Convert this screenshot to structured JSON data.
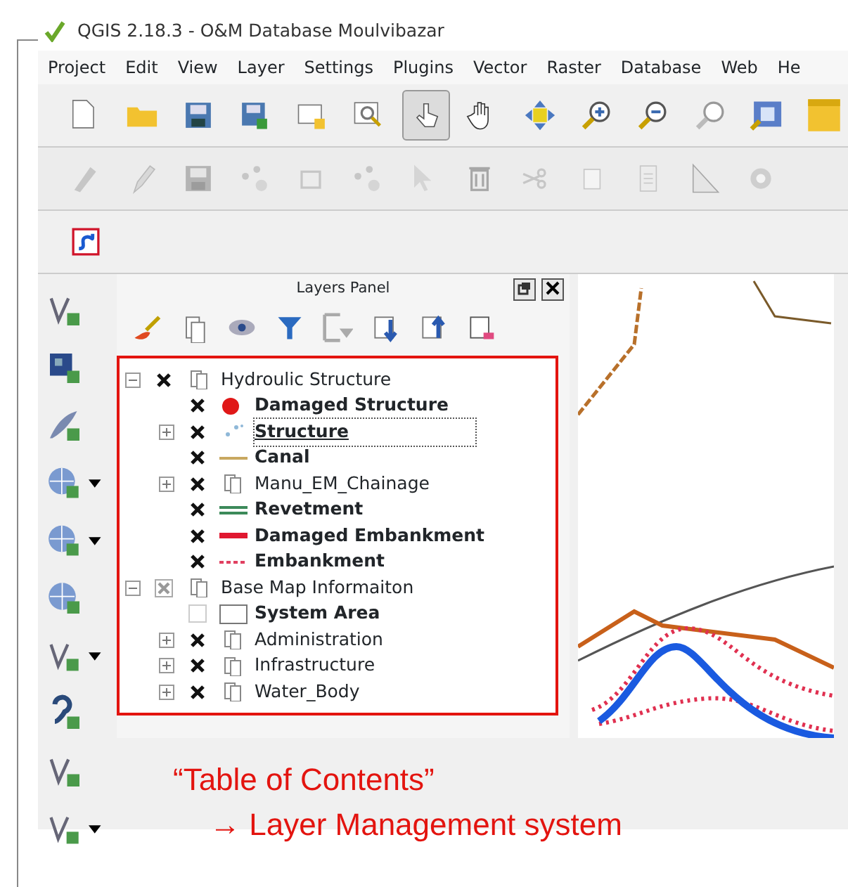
{
  "window": {
    "title": "QGIS 2.18.3 - O&M Database Moulvibazar"
  },
  "menu": [
    "Project",
    "Edit",
    "View",
    "Layer",
    "Settings",
    "Plugins",
    "Vector",
    "Raster",
    "Database",
    "Web",
    "He"
  ],
  "toolbars": [
    {
      "disabled": false,
      "buttons": [
        {
          "selected": false
        },
        {
          "selected": false
        },
        {
          "selected": false
        },
        {
          "selected": false
        },
        {
          "selected": false
        },
        {
          "selected": false
        },
        {
          "selected": true
        },
        {
          "selected": false
        },
        {
          "selected": false
        },
        {
          "selected": false
        },
        {
          "selected": false
        },
        {
          "selected": false
        },
        {
          "selected": false
        },
        {
          "selected": false
        }
      ]
    },
    {
      "disabled": true,
      "buttons": [
        {
          "selected": false
        },
        {
          "selected": false
        },
        {
          "selected": false
        },
        {
          "selected": false
        },
        {
          "selected": false
        },
        {
          "selected": false
        },
        {
          "selected": false
        },
        {
          "selected": false
        },
        {
          "selected": false
        },
        {
          "selected": false
        },
        {
          "selected": false
        },
        {
          "selected": false
        },
        {
          "selected": false
        }
      ]
    },
    {
      "disabled": false,
      "buttons": [
        {
          "selected": false
        }
      ]
    }
  ],
  "layers_panel": {
    "title": "Layers Panel",
    "tree": [
      {
        "label": "Hydroulic Structure",
        "kind": "group",
        "checked": true,
        "partial": false,
        "expanded": true,
        "selected": false,
        "children": [
          {
            "label": "Damaged Structure",
            "kind": "point",
            "color": "#e01818",
            "checked": true,
            "partial": false,
            "selected": false
          },
          {
            "label": "Structure",
            "kind": "scatter",
            "color": "#8fb8d8",
            "checked": true,
            "partial": false,
            "expanded": false,
            "selected": true
          },
          {
            "label": "Canal",
            "kind": "line",
            "color": "#c8a860",
            "checked": true,
            "partial": false,
            "selected": false
          },
          {
            "label": "Manu_EM_Chainage",
            "kind": "group",
            "checked": true,
            "partial": false,
            "expanded": false,
            "selected": false
          },
          {
            "label": "Revetment",
            "kind": "double-line",
            "color": "#3c8a5a",
            "checked": true,
            "partial": false,
            "selected": false
          },
          {
            "label": "Damaged Embankment",
            "kind": "thick-line",
            "color": "#e01830",
            "checked": true,
            "partial": false,
            "selected": false
          },
          {
            "label": "Embankment",
            "kind": "dashed-line",
            "color": "#e04060",
            "checked": true,
            "partial": false,
            "selected": false
          }
        ]
      },
      {
        "label": "Base Map Informaiton",
        "kind": "group",
        "checked": true,
        "partial": true,
        "expanded": true,
        "selected": false,
        "children": [
          {
            "label": "System Area",
            "kind": "polygon",
            "checked": false,
            "partial": false,
            "selected": false
          },
          {
            "label": "Administration",
            "kind": "group",
            "checked": true,
            "partial": false,
            "expanded": false,
            "selected": false
          },
          {
            "label": "Infrastructure",
            "kind": "group",
            "checked": true,
            "partial": false,
            "expanded": false,
            "selected": false
          },
          {
            "label": "Water_Body",
            "kind": "group",
            "checked": true,
            "partial": false,
            "expanded": false,
            "selected": false
          }
        ]
      }
    ]
  },
  "annotation": {
    "title": "“Table of Contents”",
    "subtitle": "→ Layer Management system"
  }
}
